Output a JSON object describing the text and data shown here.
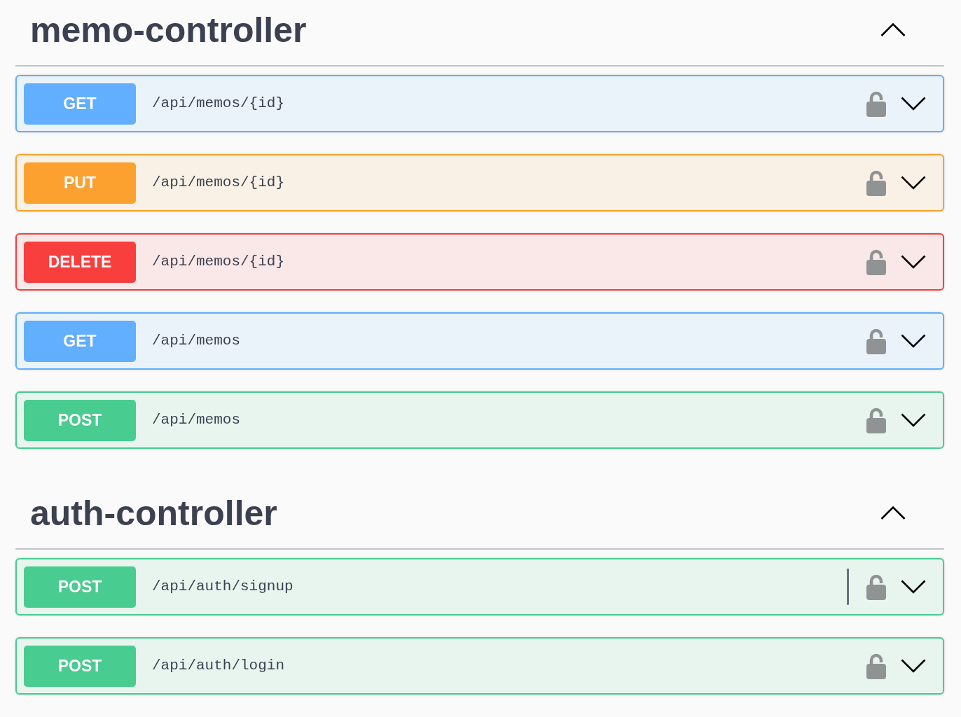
{
  "sections": [
    {
      "name": "memo-controller",
      "expanded": true,
      "operations": [
        {
          "kind": "get",
          "method": "GET",
          "path": "/api/memos/{id}",
          "locked": false,
          "expanded": false,
          "text_cursor": false
        },
        {
          "kind": "put",
          "method": "PUT",
          "path": "/api/memos/{id}",
          "locked": false,
          "expanded": false,
          "text_cursor": false
        },
        {
          "kind": "delete",
          "method": "DELETE",
          "path": "/api/memos/{id}",
          "locked": false,
          "expanded": false,
          "text_cursor": false
        },
        {
          "kind": "get",
          "method": "GET",
          "path": "/api/memos",
          "locked": false,
          "expanded": false,
          "text_cursor": false
        },
        {
          "kind": "post",
          "method": "POST",
          "path": "/api/memos",
          "locked": false,
          "expanded": false,
          "text_cursor": false
        }
      ]
    },
    {
      "name": "auth-controller",
      "expanded": true,
      "operations": [
        {
          "kind": "post",
          "method": "POST",
          "path": "/api/auth/signup",
          "locked": false,
          "expanded": false,
          "text_cursor": true
        },
        {
          "kind": "post",
          "method": "POST",
          "path": "/api/auth/login",
          "locked": false,
          "expanded": false,
          "text_cursor": false
        }
      ]
    }
  ]
}
